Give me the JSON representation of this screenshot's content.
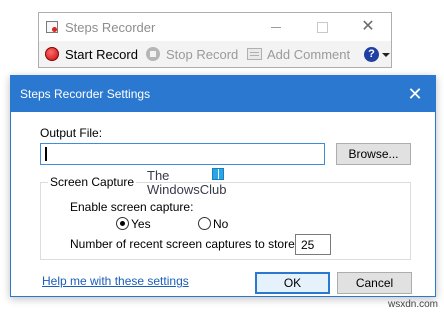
{
  "recorder": {
    "title": "Steps Recorder",
    "start_record": "Start Record",
    "stop_record": "Stop Record",
    "add_comment": "Add Comment",
    "help_glyph": "?",
    "close_glyph": "✕",
    "icons": [
      "record-icon",
      "stop-icon",
      "add-comment-icon",
      "help-icon"
    ]
  },
  "dialog": {
    "title": "Steps Recorder Settings",
    "close_glyph": "✕",
    "output_file_label": "Output File:",
    "output_file_value": "",
    "browse_label": "Browse...",
    "screen_capture_group": "Screen Capture",
    "enable_label": "Enable screen capture:",
    "yes_label": "Yes",
    "no_label": "No",
    "enable_selected": "Yes",
    "count_label": "Number of recent screen captures to store:",
    "count_value": "25",
    "help_link": "Help me with these settings",
    "ok_label": "OK",
    "cancel_label": "Cancel"
  },
  "watermark": {
    "line1": "The",
    "line2": "WindowsClub"
  },
  "site_credit": "wsxdn.com",
  "colors": {
    "accent": "#2b78d0",
    "record_red": "#d61f1f",
    "link": "#1a5dba"
  }
}
